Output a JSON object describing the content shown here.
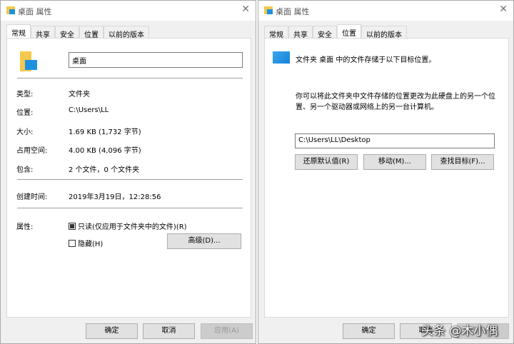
{
  "left": {
    "title": "桌面 属性",
    "tabs": [
      "常规",
      "共享",
      "安全",
      "位置",
      "以前的版本"
    ],
    "name_value": "桌面",
    "rows": [
      {
        "label": "类型:",
        "value": "文件夹"
      },
      {
        "label": "位置:",
        "value": "C:\\Users\\LL"
      },
      {
        "label": "大小:",
        "value": "1.69 KB (1,732 字节)"
      },
      {
        "label": "占用空间:",
        "value": "4.00 KB (4,096 字节)"
      },
      {
        "label": "包含:",
        "value": "2 个文件，0 个文件夹"
      }
    ],
    "created_label": "创建时间:",
    "created_value": "2019年3月19日，12:28:56",
    "attributes_label": "属性:",
    "readonly_label": "只读(仅应用于文件夹中的文件)(R)",
    "hidden_label": "隐藏(H)",
    "advanced_button": "高级(D)...",
    "ok": "确定",
    "cancel": "取消",
    "apply": "应用(A)"
  },
  "right": {
    "title": "桌面 属性",
    "tabs": [
      "常规",
      "共享",
      "安全",
      "位置",
      "以前的版本"
    ],
    "intro": "文件夹 桌面 中的文件存储于以下目标位置。",
    "desc1": "你可以将此文件夹中文件存储的位置更改为此硬盘上的另一个位",
    "desc2": "置、另一个驱动器或网络上的另一台计算机。",
    "path": "C:\\Users\\LL\\Desktop",
    "restore_button": "还原默认值(R)",
    "move_button": "移动(M)...",
    "find_button": "查找目标(F)...",
    "ok": "确定",
    "cancel": "取消",
    "apply": "应用(A)"
  },
  "watermark": "头条 @木小偶"
}
